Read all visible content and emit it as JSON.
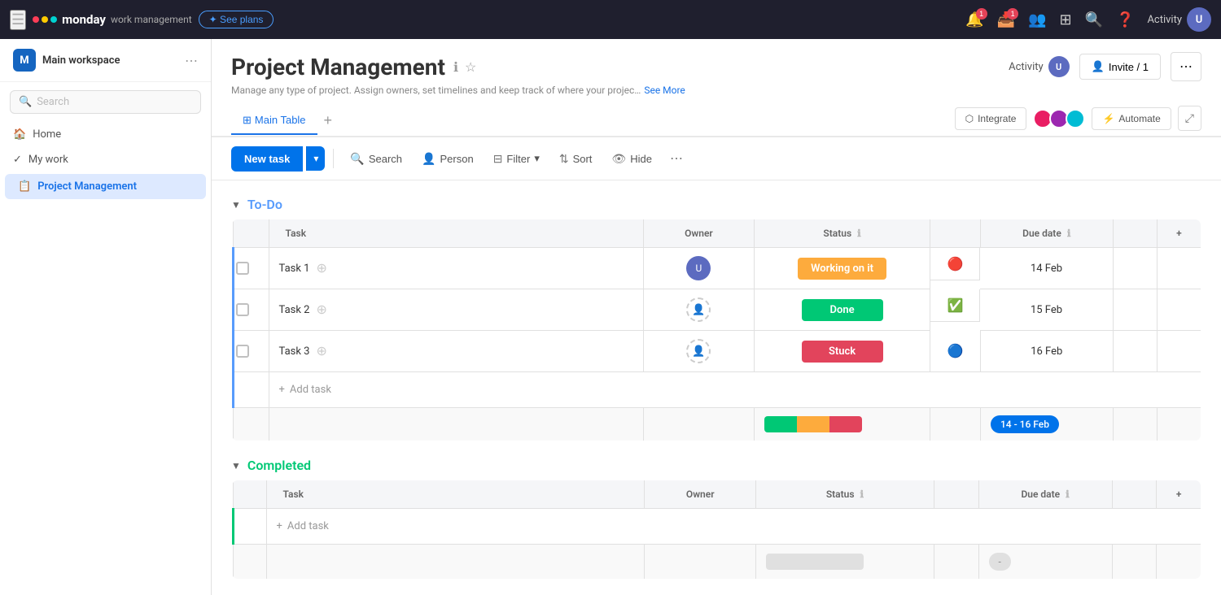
{
  "topnav": {
    "logo_text": "monday",
    "logo_subtext": "work management",
    "see_plans_label": "✦ See plans",
    "activity_label": "Activity",
    "notifications_count": "1",
    "inbox_count": "1"
  },
  "sidebar": {
    "workspace_initial": "M",
    "workspace_name": "Main workspace",
    "search_placeholder": "Search",
    "nav_items": [
      {
        "label": "Home",
        "icon": "🏠"
      },
      {
        "label": "My work",
        "icon": "✓"
      }
    ],
    "project_item": "Project Management"
  },
  "project": {
    "title": "Project Management",
    "description": "Manage any type of project. Assign owners, set timelines and keep track of where your projec…",
    "see_more": "See More"
  },
  "tabs": [
    {
      "label": "Main Table",
      "active": true
    }
  ],
  "toolbar": {
    "integrate_label": "Integrate",
    "automate_label": "Automate"
  },
  "actionbar": {
    "new_task_label": "New task",
    "search_label": "Search",
    "person_label": "Person",
    "filter_label": "Filter",
    "sort_label": "Sort",
    "hide_label": "Hide"
  },
  "header_btns": {
    "invite_label": "Invite / 1",
    "options_label": "⋯"
  },
  "groups": [
    {
      "id": "todo",
      "title": "To-Do",
      "color_class": "todo",
      "border_class": "group-border-todo",
      "columns": [
        "",
        "Task",
        "Owner",
        "Status",
        "",
        "Due date",
        "",
        "+"
      ],
      "tasks": [
        {
          "name": "Task 1",
          "status": "Working on it",
          "status_class": "status-working",
          "due_date": "14 Feb",
          "priority": "🔴",
          "priority_class": "priority-overdue",
          "has_owner": true
        },
        {
          "name": "Task 2",
          "status": "Done",
          "status_class": "status-done",
          "due_date": "15 Feb",
          "priority": "✅",
          "priority_class": "priority-done",
          "has_owner": false
        },
        {
          "name": "Task 3",
          "status": "Stuck",
          "status_class": "status-stuck",
          "due_date": "16 Feb",
          "priority": "🔵",
          "priority_class": "priority-medium",
          "has_owner": false
        }
      ],
      "add_task_label": "+ Add task",
      "date_range": "14 - 16 Feb"
    },
    {
      "id": "completed",
      "title": "Completed",
      "color_class": "completed",
      "border_class": "group-border-completed",
      "columns": [
        "",
        "Task",
        "Owner",
        "Status",
        "",
        "Due date",
        "",
        "+"
      ],
      "tasks": [],
      "add_task_label": "+ Add task",
      "date_range": "-"
    }
  ]
}
